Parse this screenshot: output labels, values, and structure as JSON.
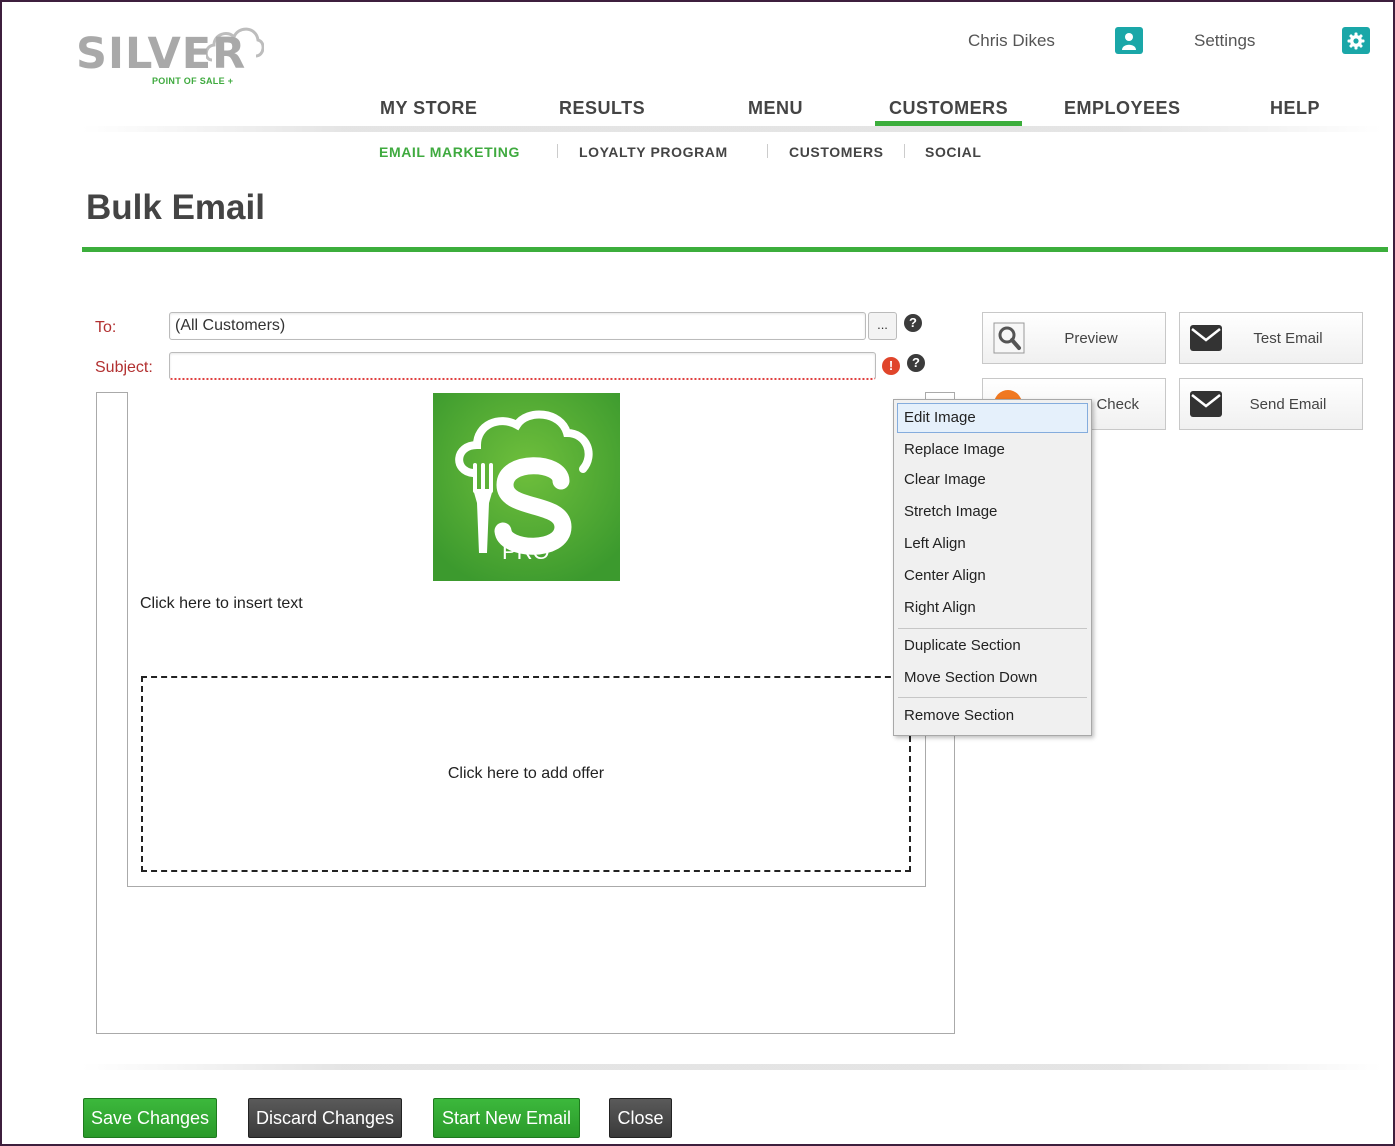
{
  "logo": {
    "word": "SILVER",
    "subtitle": "POINT OF SALE +"
  },
  "header": {
    "user_name": "Chris Dikes",
    "settings_label": "Settings"
  },
  "nav": {
    "items": [
      {
        "label": "MY STORE"
      },
      {
        "label": "RESULTS"
      },
      {
        "label": "MENU"
      },
      {
        "label": "CUSTOMERS"
      },
      {
        "label": "EMPLOYEES"
      },
      {
        "label": "HELP"
      }
    ],
    "active": "CUSTOMERS"
  },
  "subnav": {
    "items": [
      {
        "label": "EMAIL MARKETING"
      },
      {
        "label": "LOYALTY PROGRAM"
      },
      {
        "label": "CUSTOMERS"
      },
      {
        "label": "SOCIAL"
      }
    ],
    "active": "EMAIL MARKETING"
  },
  "page": {
    "title": "Bulk Email"
  },
  "form": {
    "to_label": "To:",
    "to_value": "(All Customers)",
    "browse_label": "...",
    "subject_label": "Subject:",
    "subject_value": "",
    "help_glyph": "?",
    "error_glyph": "!"
  },
  "editor": {
    "image_text": "PRO",
    "insert_text": "Click here to insert text",
    "offer_text": "Click here to add offer"
  },
  "side_buttons": {
    "preview": "Preview",
    "test_email": "Test Email",
    "check": "Check",
    "send_email": "Send Email"
  },
  "context_menu": {
    "items": [
      "Edit Image",
      "Replace Image",
      "Clear Image",
      "Stretch Image",
      "Left Align",
      "Center Align",
      "Right Align",
      "Duplicate Section",
      "Move Section Down",
      "Remove Section"
    ]
  },
  "actions": {
    "save": "Save Changes",
    "discard": "Discard Changes",
    "start_new": "Start New Email",
    "close": "Close"
  },
  "colors": {
    "brand_green": "#3cae3c",
    "teal": "#1aa7a8",
    "dark_button": "#3a3a3a",
    "error_red": "#e0452b"
  },
  "icons": {
    "user": "user-icon",
    "settings": "gear-icon",
    "preview": "magnifier-icon",
    "mail": "envelope-icon",
    "help": "question-icon",
    "error": "error-icon",
    "check": "spellcheck-icon"
  }
}
